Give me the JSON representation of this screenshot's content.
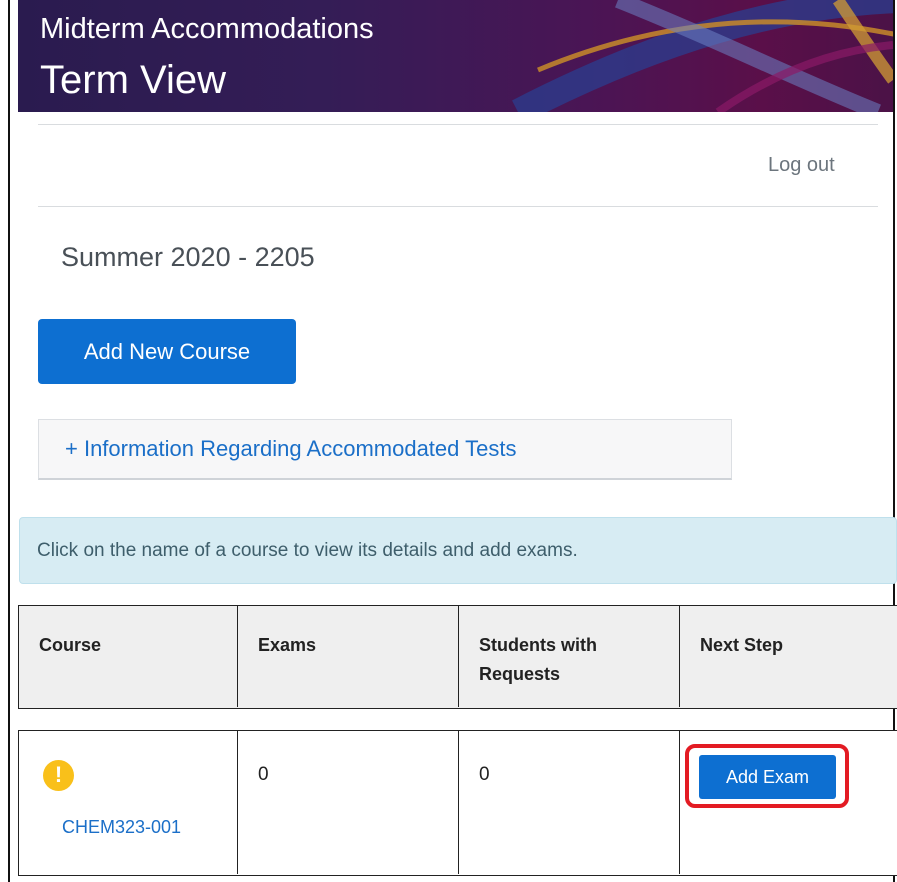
{
  "header": {
    "subtitle": "Midterm Accommodations",
    "title": "Term View"
  },
  "nav": {
    "logout_label": "Log out"
  },
  "term": {
    "heading": "Summer 2020 - 2205"
  },
  "actions": {
    "add_course_label": "Add New Course"
  },
  "info_section": {
    "collapse_label": "+ Information Regarding Accommodated Tests",
    "alert_text": "Click on the name of a course to view its details and add exams."
  },
  "table": {
    "columns": [
      "Course",
      "Exams",
      "Students with Requests",
      "Next Step"
    ],
    "rows": [
      {
        "status_icon": "exclamation-warning-icon",
        "course": "CHEM323-001",
        "exams": "0",
        "students": "0",
        "next_step_label": "Add Exam"
      }
    ]
  },
  "colors": {
    "primary": "#0d6fd1",
    "link": "#1b6fc8",
    "warning": "#f9c01a",
    "highlight": "#e31b23",
    "alert_bg": "#d7ecf3",
    "banner_bg": "#341d56"
  }
}
